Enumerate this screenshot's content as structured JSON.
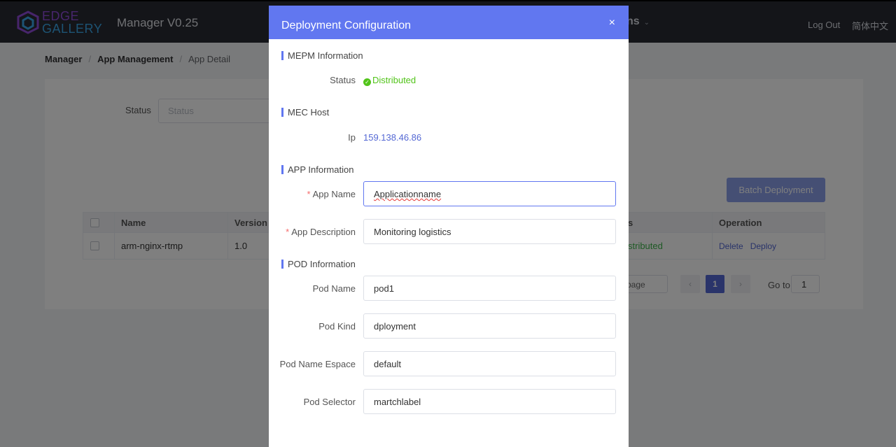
{
  "header": {
    "logo_line1": "EDGE",
    "logo_line2": "GALLERY",
    "app_title": "Manager V0.25",
    "nav_fragment": "ns",
    "logout": "Log Out",
    "language": "简体中文"
  },
  "breadcrumb": {
    "item1": "Manager",
    "item2": "App Management",
    "item3": "App Detail",
    "separator": "/"
  },
  "filter": {
    "label": "Status",
    "placeholder": "Status"
  },
  "batch_button": "Batch Deployment",
  "table": {
    "headers": {
      "name": "Name",
      "version": "Version",
      "status_fragment": "s",
      "operation": "Operation"
    },
    "rows": [
      {
        "name": "arm-nginx-rtmp",
        "version": "1.0",
        "status_fragment": "stributed",
        "delete": "Delete",
        "deploy": "Deploy"
      }
    ]
  },
  "pagination": {
    "size_fragment": "page",
    "current_page": "1",
    "goto_label": "Go to",
    "goto_value": "1"
  },
  "dialog": {
    "title": "Deployment Configuration",
    "close": "×",
    "mepm_section": "MEPM Information",
    "status_label": "Status",
    "status_value": "Distributed",
    "mec_section": "MEC Host",
    "ip_label": "Ip",
    "ip_value": "159.138.46.86",
    "app_section": "APP Information",
    "app_name_label": "App Name",
    "app_name_value": "Applicationname",
    "app_desc_label": "App Description",
    "app_desc_value": "Monitoring logistics",
    "pod_section": "POD Information",
    "pod_name_label": "Pod Name",
    "pod_name_value": "pod1",
    "pod_kind_label": "Pod Kind",
    "pod_kind_value": "dployment",
    "pod_ns_label": "Pod Name Espace",
    "pod_ns_value": "default",
    "pod_selector_label": "Pod Selector",
    "pod_selector_value": "martchlabel",
    "required_mark": "*"
  },
  "colors": {
    "accent": "#6177f0",
    "success": "#52c41a",
    "link": "#5468d4",
    "required": "#f56c6c"
  }
}
